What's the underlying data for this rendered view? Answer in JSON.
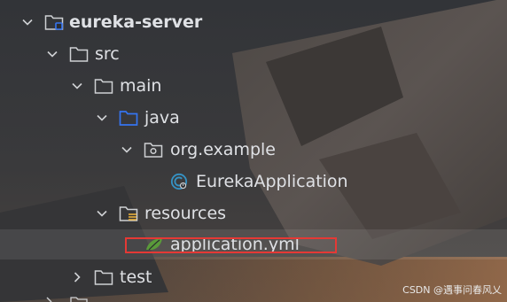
{
  "tree": {
    "items": [
      {
        "label": "eureka-server",
        "icon": "module-folder-icon",
        "expanded": true
      },
      {
        "label": "src",
        "icon": "folder-icon",
        "expanded": true
      },
      {
        "label": "main",
        "icon": "folder-icon",
        "expanded": true
      },
      {
        "label": "java",
        "icon": "source-folder-icon",
        "expanded": true
      },
      {
        "label": "org.example",
        "icon": "package-icon",
        "expanded": true
      },
      {
        "label": "EurekaApplication",
        "icon": "spring-class-icon"
      },
      {
        "label": "resources",
        "icon": "resources-folder-icon",
        "expanded": true
      },
      {
        "label": "application.yml",
        "icon": "yaml-file-icon",
        "selected": true
      },
      {
        "label": "test",
        "icon": "folder-icon",
        "expanded": false
      }
    ]
  },
  "watermark": "CSDN @遇事问春风乂",
  "colors": {
    "text": "#dfe1e5",
    "source_folder": "#3574f0",
    "highlight_border": "#e53935",
    "spring_icon": "#3592c4",
    "yaml_icon": "#5a9a3a"
  }
}
